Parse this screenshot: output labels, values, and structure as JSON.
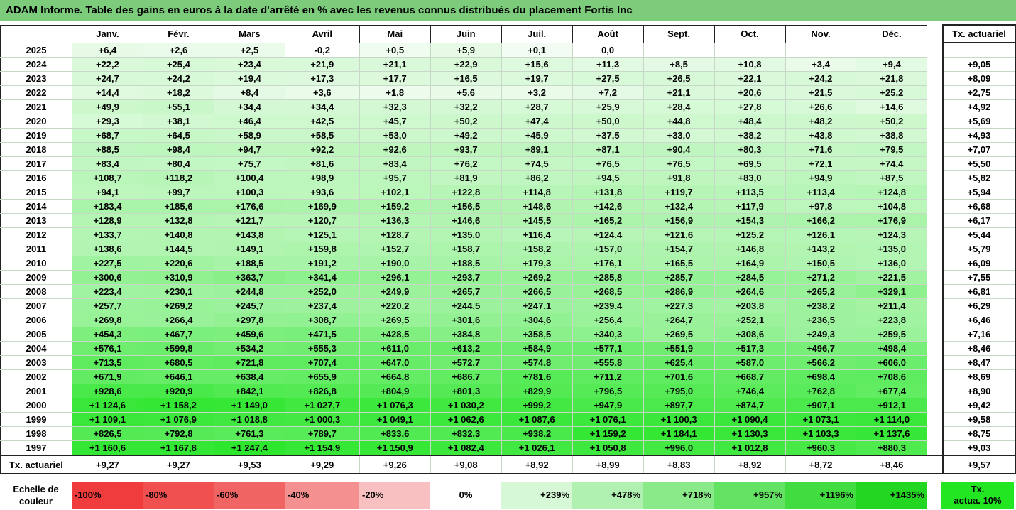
{
  "title": "ADAM Informe. Table des gains en euros à la date d'arrêté en % avec les revenus connus distribués du placement Fortis Inc",
  "months": [
    "Janv.",
    "Févr.",
    "Mars",
    "Avril",
    "Mai",
    "Juin",
    "Juil.",
    "Août",
    "Sept.",
    "Oct.",
    "Nov.",
    "Déc."
  ],
  "actuarial_header": "Tx. actuariel",
  "rows": [
    {
      "year": "2025",
      "cells": [
        "+6,4",
        "+2,6",
        "+2,5",
        "-0,2",
        "+0,5",
        "+5,9",
        "+0,1",
        "0,0",
        "",
        "",
        "",
        ""
      ],
      "act": ""
    },
    {
      "year": "2024",
      "cells": [
        "+22,2",
        "+25,4",
        "+23,4",
        "+21,9",
        "+21,1",
        "+22,9",
        "+15,6",
        "+11,3",
        "+8,5",
        "+10,8",
        "+3,4",
        "+9,4"
      ],
      "act": "+9,05"
    },
    {
      "year": "2023",
      "cells": [
        "+24,7",
        "+24,2",
        "+19,4",
        "+17,3",
        "+17,7",
        "+16,5",
        "+19,7",
        "+27,5",
        "+26,5",
        "+22,1",
        "+24,2",
        "+21,8"
      ],
      "act": "+8,09"
    },
    {
      "year": "2022",
      "cells": [
        "+14,4",
        "+18,2",
        "+8,4",
        "+3,6",
        "+1,8",
        "+5,6",
        "+3,2",
        "+7,2",
        "+21,1",
        "+20,6",
        "+21,5",
        "+25,2"
      ],
      "act": "+2,75"
    },
    {
      "year": "2021",
      "cells": [
        "+49,9",
        "+55,1",
        "+34,4",
        "+34,4",
        "+32,3",
        "+32,2",
        "+28,7",
        "+25,9",
        "+28,4",
        "+27,8",
        "+26,6",
        "+14,6"
      ],
      "act": "+4,92"
    },
    {
      "year": "2020",
      "cells": [
        "+29,3",
        "+38,1",
        "+46,4",
        "+42,5",
        "+45,7",
        "+50,2",
        "+47,4",
        "+50,0",
        "+44,8",
        "+48,4",
        "+48,2",
        "+50,2"
      ],
      "act": "+5,69"
    },
    {
      "year": "2019",
      "cells": [
        "+68,7",
        "+64,5",
        "+58,9",
        "+58,5",
        "+53,0",
        "+49,2",
        "+45,9",
        "+37,5",
        "+33,0",
        "+38,2",
        "+43,8",
        "+38,8"
      ],
      "act": "+4,93"
    },
    {
      "year": "2018",
      "cells": [
        "+88,5",
        "+98,4",
        "+94,7",
        "+92,2",
        "+92,6",
        "+93,7",
        "+89,1",
        "+87,1",
        "+90,4",
        "+80,3",
        "+71,6",
        "+79,5"
      ],
      "act": "+7,07"
    },
    {
      "year": "2017",
      "cells": [
        "+83,4",
        "+80,4",
        "+75,7",
        "+81,6",
        "+83,4",
        "+76,2",
        "+74,5",
        "+76,5",
        "+76,5",
        "+69,5",
        "+72,1",
        "+74,4"
      ],
      "act": "+5,50"
    },
    {
      "year": "2016",
      "cells": [
        "+108,7",
        "+118,2",
        "+100,4",
        "+98,9",
        "+95,7",
        "+81,9",
        "+86,2",
        "+94,5",
        "+91,8",
        "+83,0",
        "+94,9",
        "+87,5"
      ],
      "act": "+5,82"
    },
    {
      "year": "2015",
      "cells": [
        "+94,1",
        "+99,7",
        "+100,3",
        "+93,6",
        "+102,1",
        "+122,8",
        "+114,8",
        "+131,8",
        "+119,7",
        "+113,5",
        "+113,4",
        "+124,8"
      ],
      "act": "+5,94"
    },
    {
      "year": "2014",
      "cells": [
        "+183,4",
        "+185,6",
        "+176,6",
        "+169,9",
        "+159,2",
        "+156,5",
        "+148,6",
        "+142,6",
        "+132,4",
        "+117,9",
        "+97,8",
        "+104,8"
      ],
      "act": "+6,68"
    },
    {
      "year": "2013",
      "cells": [
        "+128,9",
        "+132,8",
        "+121,7",
        "+120,7",
        "+136,3",
        "+146,6",
        "+145,5",
        "+165,2",
        "+156,9",
        "+154,3",
        "+166,2",
        "+176,9"
      ],
      "act": "+6,17"
    },
    {
      "year": "2012",
      "cells": [
        "+133,7",
        "+140,8",
        "+143,8",
        "+125,1",
        "+128,7",
        "+135,0",
        "+116,4",
        "+124,4",
        "+121,6",
        "+125,2",
        "+126,1",
        "+124,3"
      ],
      "act": "+5,44"
    },
    {
      "year": "2011",
      "cells": [
        "+138,6",
        "+144,5",
        "+149,1",
        "+159,8",
        "+152,7",
        "+158,7",
        "+158,2",
        "+157,0",
        "+154,7",
        "+146,8",
        "+143,2",
        "+135,0"
      ],
      "act": "+5,79"
    },
    {
      "year": "2010",
      "cells": [
        "+227,5",
        "+220,6",
        "+188,5",
        "+191,2",
        "+190,0",
        "+188,5",
        "+179,3",
        "+176,1",
        "+165,5",
        "+164,9",
        "+150,5",
        "+136,0"
      ],
      "act": "+6,09"
    },
    {
      "year": "2009",
      "cells": [
        "+300,6",
        "+310,9",
        "+363,7",
        "+341,4",
        "+296,1",
        "+293,7",
        "+269,2",
        "+285,8",
        "+285,7",
        "+284,5",
        "+271,2",
        "+221,5"
      ],
      "act": "+7,55"
    },
    {
      "year": "2008",
      "cells": [
        "+223,4",
        "+230,1",
        "+244,8",
        "+252,0",
        "+249,9",
        "+265,7",
        "+266,5",
        "+268,5",
        "+286,9",
        "+264,6",
        "+265,2",
        "+329,1"
      ],
      "act": "+6,81"
    },
    {
      "year": "2007",
      "cells": [
        "+257,7",
        "+269,2",
        "+245,7",
        "+237,4",
        "+220,2",
        "+244,5",
        "+247,1",
        "+239,4",
        "+227,3",
        "+203,8",
        "+238,2",
        "+211,4"
      ],
      "act": "+6,29"
    },
    {
      "year": "2006",
      "cells": [
        "+269,8",
        "+266,4",
        "+297,8",
        "+308,7",
        "+269,5",
        "+301,6",
        "+304,6",
        "+256,4",
        "+264,7",
        "+252,1",
        "+236,5",
        "+223,8"
      ],
      "act": "+6,46"
    },
    {
      "year": "2005",
      "cells": [
        "+454,3",
        "+467,7",
        "+459,6",
        "+471,5",
        "+428,5",
        "+384,8",
        "+358,5",
        "+340,3",
        "+269,5",
        "+308,6",
        "+249,3",
        "+259,5"
      ],
      "act": "+7,16"
    },
    {
      "year": "2004",
      "cells": [
        "+576,1",
        "+599,8",
        "+534,2",
        "+555,3",
        "+611,0",
        "+613,2",
        "+584,9",
        "+577,1",
        "+551,9",
        "+517,3",
        "+496,7",
        "+498,4"
      ],
      "act": "+8,46"
    },
    {
      "year": "2003",
      "cells": [
        "+713,5",
        "+680,5",
        "+721,8",
        "+707,4",
        "+647,0",
        "+572,7",
        "+574,8",
        "+555,8",
        "+625,4",
        "+587,0",
        "+566,2",
        "+606,0"
      ],
      "act": "+8,47"
    },
    {
      "year": "2002",
      "cells": [
        "+671,9",
        "+646,1",
        "+638,4",
        "+655,9",
        "+664,8",
        "+686,7",
        "+781,6",
        "+711,2",
        "+701,6",
        "+668,7",
        "+698,4",
        "+708,6"
      ],
      "act": "+8,69"
    },
    {
      "year": "2001",
      "cells": [
        "+928,6",
        "+920,9",
        "+842,1",
        "+826,8",
        "+804,9",
        "+801,3",
        "+829,9",
        "+796,5",
        "+795,0",
        "+746,4",
        "+762,8",
        "+677,4"
      ],
      "act": "+8,90"
    },
    {
      "year": "2000",
      "cells": [
        "+1 124,6",
        "+1 158,2",
        "+1 149,0",
        "+1 027,7",
        "+1 076,3",
        "+1 030,2",
        "+999,2",
        "+947,9",
        "+897,7",
        "+874,7",
        "+907,1",
        "+912,1"
      ],
      "act": "+9,42"
    },
    {
      "year": "1999",
      "cells": [
        "+1 109,1",
        "+1 076,9",
        "+1 018,8",
        "+1 000,3",
        "+1 049,1",
        "+1 062,6",
        "+1 087,6",
        "+1 076,1",
        "+1 100,3",
        "+1 090,4",
        "+1 073,1",
        "+1 114,0"
      ],
      "act": "+9,58"
    },
    {
      "year": "1998",
      "cells": [
        "+826,5",
        "+792,8",
        "+761,3",
        "+789,7",
        "+833,6",
        "+832,3",
        "+938,2",
        "+1 159,2",
        "+1 184,1",
        "+1 130,3",
        "+1 103,3",
        "+1 137,6"
      ],
      "act": "+8,75"
    },
    {
      "year": "1997",
      "cells": [
        "+1 160,6",
        "+1 167,8",
        "+1 247,4",
        "+1 154,9",
        "+1 150,9",
        "+1 082,4",
        "+1 026,1",
        "+1 050,8",
        "+996,0",
        "+1 012,8",
        "+960,3",
        "+880,3"
      ],
      "act": "+9,03"
    }
  ],
  "footer": {
    "label": "Tx. actuariel",
    "cells": [
      "+9,27",
      "+9,27",
      "+9,53",
      "+9,29",
      "+9,26",
      "+9,08",
      "+8,92",
      "+8,99",
      "+8,83",
      "+8,92",
      "+8,72",
      "+8,46"
    ],
    "act": "+9,57"
  },
  "scale": {
    "label_line1": "Echelle de",
    "label_line2": "couleur",
    "steps": [
      {
        "text": "-100%",
        "color": "#f03c3c",
        "align": "left"
      },
      {
        "text": "-80%",
        "color": "#f05050",
        "align": "left"
      },
      {
        "text": "-60%",
        "color": "#f06464",
        "align": "left"
      },
      {
        "text": "-40%",
        "color": "#f59090",
        "align": "left"
      },
      {
        "text": "-20%",
        "color": "#f8c0c0",
        "align": "left"
      },
      {
        "text": "0%",
        "color": "#ffffff",
        "align": "center"
      },
      {
        "text": "+239%",
        "color": "#d6f8d6",
        "align": "right"
      },
      {
        "text": "+478%",
        "color": "#b0f0b0",
        "align": "right"
      },
      {
        "text": "+718%",
        "color": "#8aea8a",
        "align": "right"
      },
      {
        "text": "+957%",
        "color": "#64e264",
        "align": "right"
      },
      {
        "text": "+1196%",
        "color": "#40dc40",
        "align": "right"
      },
      {
        "text": "+1435%",
        "color": "#22d622",
        "align": "right"
      }
    ],
    "tx_line1": "Tx.",
    "tx_line2": "actua. 10%"
  },
  "colors": {
    "title_bg": "#7ccc7c",
    "gain_min": "#f4fcf4",
    "gain_max": "#2ee62e"
  }
}
